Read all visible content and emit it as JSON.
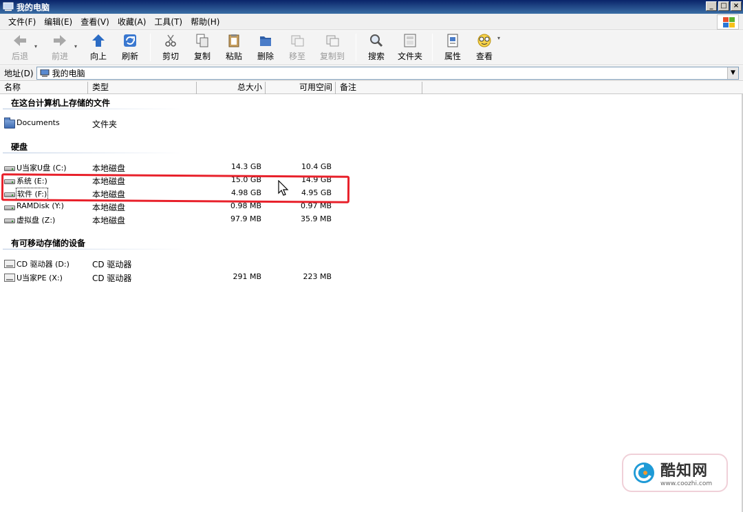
{
  "window": {
    "title": "我的电脑"
  },
  "window_buttons": [
    "_",
    "□",
    "×"
  ],
  "menu": [
    "文件(F)",
    "编辑(E)",
    "查看(V)",
    "收藏(A)",
    "工具(T)",
    "帮助(H)"
  ],
  "toolbar": {
    "back": "后退",
    "forward": "前进",
    "up": "向上",
    "refresh": "刷新",
    "cut": "剪切",
    "copy": "复制",
    "paste": "粘贴",
    "delete": "删除",
    "move_to": "移至",
    "copy_to": "复制到",
    "search": "搜索",
    "folders": "文件夹",
    "properties": "属性",
    "view": "查看"
  },
  "address": {
    "label": "地址(D)",
    "value": "我的电脑"
  },
  "columns": {
    "name": "名称",
    "type": "类型",
    "total": "总大小",
    "free": "可用空间",
    "note": "备注"
  },
  "groups": {
    "stored": "在这台计算机上存储的文件",
    "hdd": "硬盘",
    "removable": "有可移动存储的设备"
  },
  "stored_items": [
    {
      "name": "Documents",
      "type": "文件夹",
      "icon": "folder-icon"
    }
  ],
  "hdd_items": [
    {
      "name": "U当家U盘 (C:)",
      "type": "本地磁盘",
      "total": "14.3 GB",
      "free": "10.4 GB",
      "icon": "hard-drive-icon"
    },
    {
      "name": "系统 (E:)",
      "type": "本地磁盘",
      "total": "15.0 GB",
      "free": "14.9 GB",
      "icon": "hard-drive-icon"
    },
    {
      "name": "软件 (F:)",
      "type": "本地磁盘",
      "total": "4.98 GB",
      "free": "4.95 GB",
      "icon": "hard-drive-icon"
    },
    {
      "name": "RAMDisk (Y:)",
      "type": "本地磁盘",
      "total": "0.98 MB",
      "free": "0.97 MB",
      "icon": "hard-drive-icon"
    },
    {
      "name": "虚拟盘 (Z:)",
      "type": "本地磁盘",
      "total": "97.9 MB",
      "free": "35.9 MB",
      "icon": "hard-drive-icon"
    }
  ],
  "removable_items": [
    {
      "name": "CD 驱动器 (D:)",
      "type": "CD 驱动器",
      "total": "",
      "free": "",
      "icon": "cd-drive-icon"
    },
    {
      "name": "U当家PE (X:)",
      "type": "CD 驱动器",
      "total": "291 MB",
      "free": "223 MB",
      "icon": "cd-drive-icon"
    }
  ],
  "watermark": {
    "name": "酷知网",
    "url": "www.coozhi.com"
  },
  "colors": {
    "highlight": "#e8202a",
    "title_bar": "#0a246a"
  }
}
